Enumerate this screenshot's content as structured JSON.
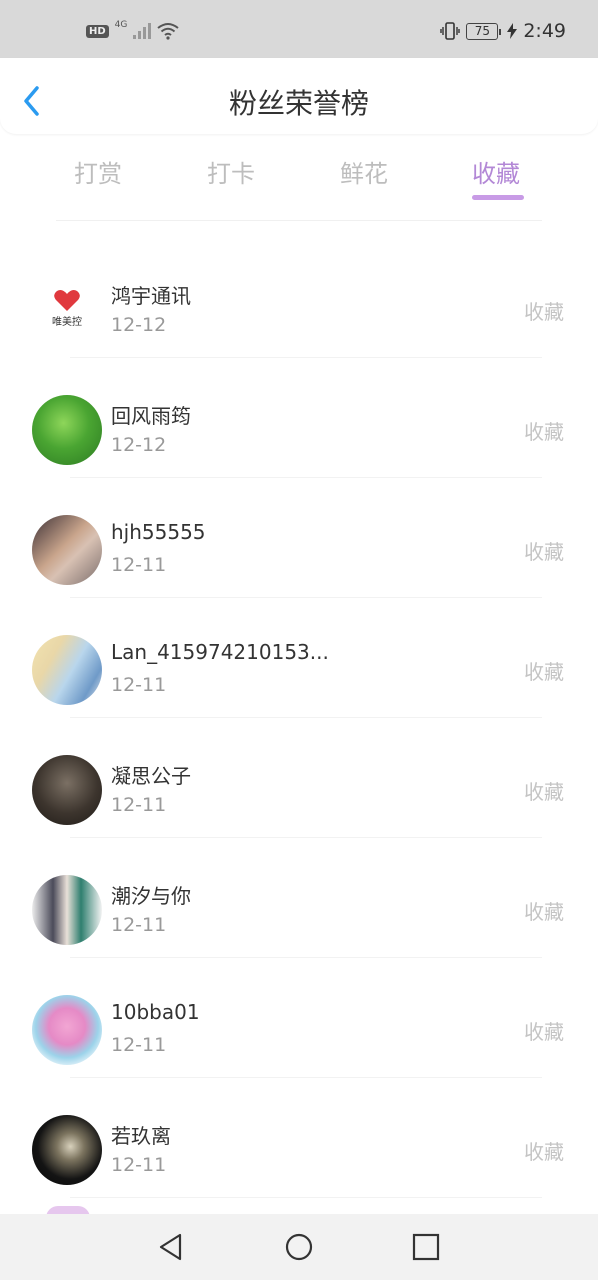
{
  "status_bar": {
    "hd": "HD",
    "network": "4G",
    "battery": "75",
    "time": "2:49"
  },
  "header": {
    "title": "粉丝荣誉榜",
    "back_icon": "chevron-left-icon",
    "back_color": "#2b9bf0"
  },
  "tabs": [
    {
      "label": "打赏",
      "active": false
    },
    {
      "label": "打卡",
      "active": false
    },
    {
      "label": "鲜花",
      "active": false
    },
    {
      "label": "收藏",
      "active": true
    }
  ],
  "accent_color": "#b388d6",
  "list": [
    {
      "name": "鸿宇通讯",
      "date": "12-12",
      "action": "收藏",
      "avatar": "logo-heart"
    },
    {
      "name": "回风雨筠",
      "date": "12-12",
      "action": "收藏",
      "avatar": "green-leaf"
    },
    {
      "name": "hjh55555",
      "date": "12-11",
      "action": "收藏",
      "avatar": "photo-person"
    },
    {
      "name": "Lan_415974210153...",
      "date": "12-11",
      "action": "收藏",
      "avatar": "anime-two"
    },
    {
      "name": "凝思公子",
      "date": "12-11",
      "action": "收藏",
      "avatar": "dark-photo"
    },
    {
      "name": "潮汐与你",
      "date": "12-11",
      "action": "收藏",
      "avatar": "anime-group"
    },
    {
      "name": "10bba01",
      "date": "12-11",
      "action": "收藏",
      "avatar": "anime-pink"
    },
    {
      "name": "若玖离",
      "date": "12-11",
      "action": "收藏",
      "avatar": "dark-anime"
    }
  ],
  "avatar_logo_text": "唯美控",
  "nav": {
    "back_icon": "triangle-back-icon",
    "home_icon": "circle-home-icon",
    "recent_icon": "square-recents-icon"
  }
}
